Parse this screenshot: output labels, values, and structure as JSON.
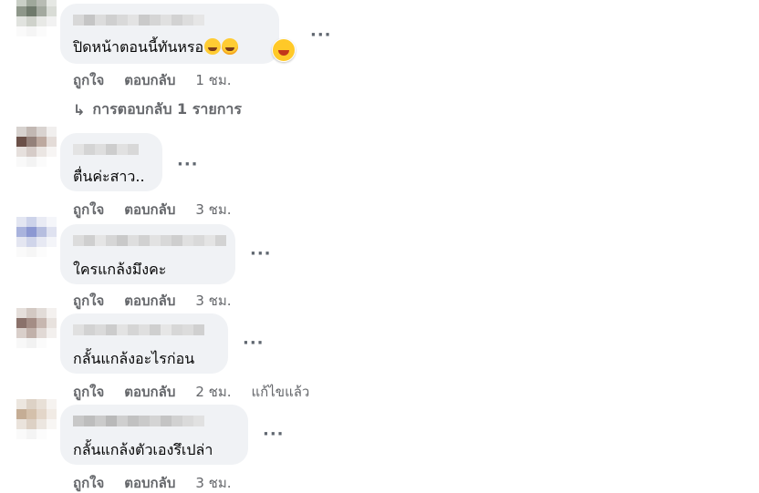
{
  "comments": [
    {
      "text": "ปิดหน้าตอนนี้ทันหรอ",
      "emojis": [
        "grinning-sweat-emoji",
        "crying-laughing-emoji"
      ],
      "reaction": "laughing-emoji",
      "like": "ถูกใจ",
      "reply": "ตอบกลับ",
      "time": "1 ชม."
    },
    {
      "text": "ตื่นค่ะสาว..",
      "like": "ถูกใจ",
      "reply": "ตอบกลับ",
      "time": "3 ชม."
    },
    {
      "text": "ใครแกล้งมึงคะ",
      "like": "ถูกใจ",
      "reply": "ตอบกลับ",
      "time": "3 ชม."
    },
    {
      "text": "กลั้นแกล้งอะไรก่อน",
      "like": "ถูกใจ",
      "reply": "ตอบกลับ",
      "time": "2 ชม.",
      "edited": "แก้ไขแล้ว"
    },
    {
      "text": "กลั้นแกล้งตัวเองรึเปล่า",
      "like": "ถูกใจ",
      "reply": "ตอบกลับ",
      "time": "3 ชม."
    }
  ],
  "replies_link": "การตอบกลับ 1 รายการ",
  "more_glyph": "···",
  "colors": {
    "bubble": "#f0f2f5",
    "text": "#050505",
    "meta": "#65676b"
  }
}
